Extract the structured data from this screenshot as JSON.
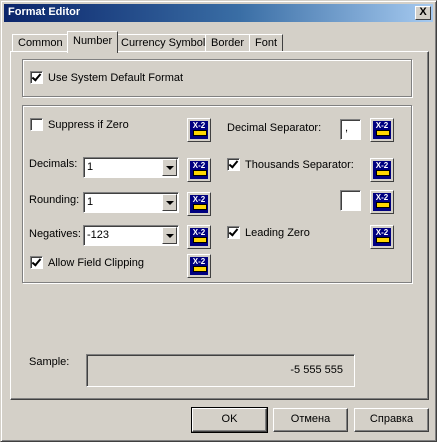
{
  "window": {
    "title": "Format Editor",
    "close_label": "X"
  },
  "tabs": [
    {
      "label": "Common"
    },
    {
      "label": "Number"
    },
    {
      "label": "Currency Symbol"
    },
    {
      "label": "Border"
    },
    {
      "label": "Font"
    }
  ],
  "active_tab": "Number",
  "system_default": {
    "label": "Use System Default Format",
    "checked": true
  },
  "suppress_zero": {
    "label": "Suppress if Zero",
    "checked": false
  },
  "decimals": {
    "label": "Decimals:",
    "value": "1"
  },
  "rounding": {
    "label": "Rounding:",
    "value": "1"
  },
  "negatives": {
    "label": "Negatives:",
    "value": "-123"
  },
  "allow_clipping": {
    "label": "Allow Field Clipping",
    "checked": true
  },
  "decimal_separator": {
    "label": "Decimal Separator:",
    "value": ","
  },
  "thousands_separator": {
    "label": "Thousands Separator:",
    "checked": true,
    "value": ""
  },
  "leading_zero": {
    "label": "Leading Zero",
    "checked": true
  },
  "formula_button": {
    "text": "X-2"
  },
  "sample": {
    "label": "Sample:",
    "value": "-5 555 555"
  },
  "buttons": {
    "ok": "OK",
    "cancel": "Отмена",
    "help": "Справка"
  }
}
